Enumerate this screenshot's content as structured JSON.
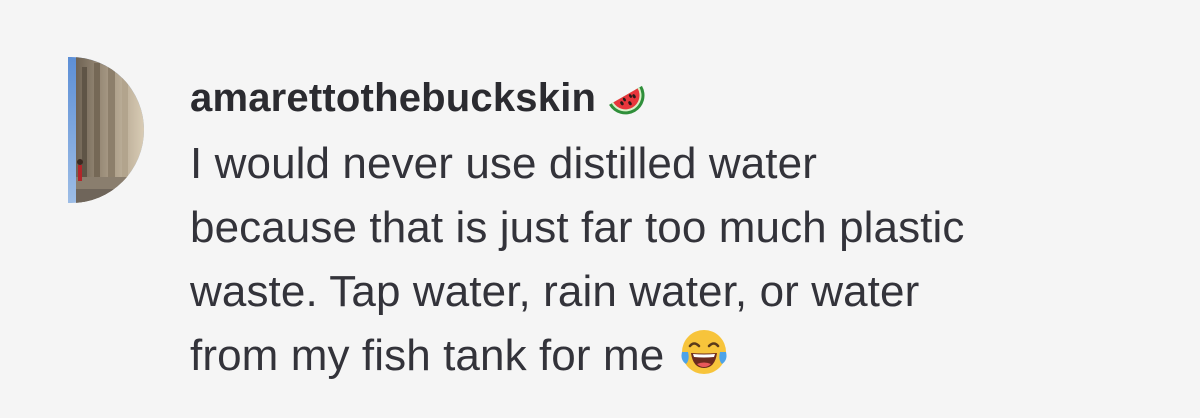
{
  "comment": {
    "avatar_icon": "user-avatar-photo",
    "username": "amarettothebuckskin",
    "username_emoji": "watermelon-icon",
    "text_lines": [
      "I would never use distilled water",
      "because that is just far too much plastic",
      "waste. Tap water, rain water, or water",
      "from my fish tank for me"
    ],
    "trailing_emoji": "tears-of-joy-icon"
  },
  "colors": {
    "background": "#f5f5f5",
    "text": "#33333a",
    "username": "#2b2b30"
  }
}
